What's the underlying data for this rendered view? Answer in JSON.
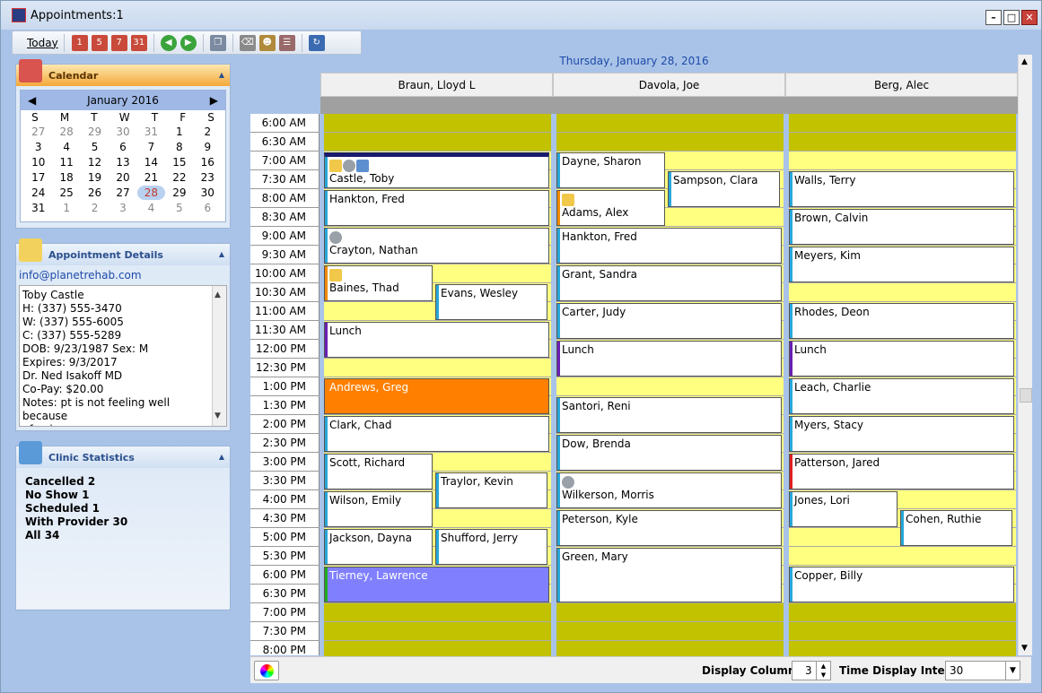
{
  "window": {
    "title": "Appointments:1"
  },
  "toolbar": {
    "today_label": "Today"
  },
  "calendar": {
    "panel_title": "Calendar",
    "month_label": "January 2016",
    "dow": [
      "S",
      "M",
      "T",
      "W",
      "T",
      "F",
      "S"
    ],
    "days": [
      {
        "d": "27",
        "o": true
      },
      {
        "d": "28",
        "o": true
      },
      {
        "d": "29",
        "o": true
      },
      {
        "d": "30",
        "o": true
      },
      {
        "d": "31",
        "o": true
      },
      {
        "d": "1"
      },
      {
        "d": "2"
      },
      {
        "d": "3"
      },
      {
        "d": "4"
      },
      {
        "d": "5"
      },
      {
        "d": "6"
      },
      {
        "d": "7"
      },
      {
        "d": "8"
      },
      {
        "d": "9"
      },
      {
        "d": "10"
      },
      {
        "d": "11"
      },
      {
        "d": "12"
      },
      {
        "d": "13"
      },
      {
        "d": "14"
      },
      {
        "d": "15"
      },
      {
        "d": "16"
      },
      {
        "d": "17"
      },
      {
        "d": "18"
      },
      {
        "d": "19"
      },
      {
        "d": "20"
      },
      {
        "d": "21"
      },
      {
        "d": "22"
      },
      {
        "d": "23"
      },
      {
        "d": "24"
      },
      {
        "d": "25"
      },
      {
        "d": "26"
      },
      {
        "d": "27"
      },
      {
        "d": "28",
        "sel": true
      },
      {
        "d": "29"
      },
      {
        "d": "30"
      },
      {
        "d": "31"
      },
      {
        "d": "1",
        "o": true
      },
      {
        "d": "2",
        "o": true
      },
      {
        "d": "3",
        "o": true
      },
      {
        "d": "4",
        "o": true
      },
      {
        "d": "5",
        "o": true
      },
      {
        "d": "6",
        "o": true
      }
    ]
  },
  "details": {
    "panel_title": "Appointment Details",
    "email": "info@planetrehab.com",
    "lines": [
      "Toby  Castle",
      "H: (337) 555-3470",
      "W: (337) 555-6005",
      "C: (337) 555-5289",
      "DOB: 9/23/1987 Sex: M",
      "Expires: 9/3/2017",
      "Dr. Ned  Isakoff MD",
      "Co-Pay: $20.00",
      "Notes: pt is not feeling well because",
      "of pain."
    ]
  },
  "stats": {
    "panel_title": "Clinic Statistics",
    "lines": [
      "Cancelled 2",
      "No Show 1",
      "Scheduled 1",
      "With Provider 30",
      "All 34"
    ]
  },
  "schedule": {
    "date_label": "Thursday, January 28, 2016",
    "times": [
      "6:00 AM",
      "6:30 AM",
      "7:00 AM",
      "7:30 AM",
      "8:00 AM",
      "8:30 AM",
      "9:00 AM",
      "9:30 AM",
      "10:00 AM",
      "10:30 AM",
      "11:00 AM",
      "11:30 AM",
      "12:00 PM",
      "12:30 PM",
      "1:00 PM",
      "1:30 PM",
      "2:00 PM",
      "2:30 PM",
      "3:00 PM",
      "3:30 PM",
      "4:00 PM",
      "4:30 PM",
      "5:00 PM",
      "5:30 PM",
      "6:00 PM",
      "6:30 PM",
      "7:00 PM",
      "7:30 PM",
      "8:00 PM"
    ],
    "resources": [
      {
        "name": "Braun, Lloyd L",
        "closed_slots": [
          0,
          1,
          26,
          27,
          28
        ],
        "appointments": [
          {
            "name": "Castle, Toby",
            "start": 2,
            "len": 2,
            "half": "full",
            "icons": [
              "note",
              "dollar",
              "grid"
            ],
            "bar": "#29a7d8",
            "topbar": true
          },
          {
            "name": "Hankton, Fred",
            "start": 4,
            "len": 2,
            "half": "full",
            "bar": "#29a7d8"
          },
          {
            "name": "Crayton, Nathan",
            "start": 6,
            "len": 2,
            "half": "full",
            "icons": [
              "dollar"
            ],
            "bar": "#29a7d8"
          },
          {
            "name": "Baines, Thad",
            "start": 8,
            "len": 2,
            "half": "left",
            "icons": [
              "note"
            ],
            "bar": "#f08a00"
          },
          {
            "name": "Evans, Wesley",
            "start": 9,
            "len": 2,
            "half": "right",
            "bar": "#29a7d8"
          },
          {
            "name": "Lunch",
            "start": 11,
            "len": 2,
            "half": "full",
            "bar": "#6a1fb0"
          },
          {
            "name": "Andrews, Greg",
            "start": 14,
            "len": 2,
            "half": "full",
            "bg": "#ff8000",
            "fg": "#ffffff",
            "bar": "#ff8000"
          },
          {
            "name": "Clark, Chad",
            "start": 16,
            "len": 2,
            "half": "full",
            "bar": "#29a7d8"
          },
          {
            "name": "Scott, Richard",
            "start": 18,
            "len": 2,
            "half": "left",
            "bar": "#29a7d8"
          },
          {
            "name": "Traylor, Kevin",
            "start": 19,
            "len": 2,
            "half": "right",
            "bar": "#29a7d8"
          },
          {
            "name": "Wilson, Emily",
            "start": 20,
            "len": 2,
            "half": "left",
            "bar": "#29a7d8"
          },
          {
            "name": "Jackson, Dayna",
            "start": 22,
            "len": 2,
            "half": "left",
            "bar": "#29a7d8"
          },
          {
            "name": "Shufford, Jerry",
            "start": 22,
            "len": 2,
            "half": "right",
            "bar": "#29a7d8"
          },
          {
            "name": "Tierney, Lawrence",
            "start": 24,
            "len": 2,
            "half": "full",
            "bg": "#8080ff",
            "fg": "#ffffff",
            "bar": "#22aa22"
          }
        ]
      },
      {
        "name": "Davola, Joe",
        "closed_slots": [
          0,
          1,
          26,
          27,
          28
        ],
        "appointments": [
          {
            "name": "Dayne, Sharon",
            "start": 2,
            "len": 2,
            "half": "left",
            "bar": "#29a7d8"
          },
          {
            "name": "Sampson, Clara",
            "start": 3,
            "len": 2,
            "half": "right",
            "bar": "#29a7d8"
          },
          {
            "name": "Adams, Alex",
            "start": 4,
            "len": 2,
            "half": "left",
            "icons": [
              "note"
            ],
            "bar": "#f08a00"
          },
          {
            "name": "Hankton, Fred",
            "start": 6,
            "len": 2,
            "half": "full",
            "bar": "#29a7d8"
          },
          {
            "name": "Grant, Sandra",
            "start": 8,
            "len": 2,
            "half": "full",
            "bar": "#29a7d8"
          },
          {
            "name": "Carter, Judy",
            "start": 10,
            "len": 2,
            "half": "full",
            "bar": "#29a7d8"
          },
          {
            "name": "Lunch",
            "start": 12,
            "len": 2,
            "half": "full",
            "bar": "#6a1fb0"
          },
          {
            "name": "Santori, Reni",
            "start": 15,
            "len": 2,
            "half": "full",
            "bar": "#29a7d8"
          },
          {
            "name": "Dow, Brenda",
            "start": 17,
            "len": 2,
            "half": "full",
            "bar": "#29a7d8"
          },
          {
            "name": "Wilkerson, Morris",
            "start": 19,
            "len": 2,
            "half": "full",
            "icons": [
              "dollar"
            ],
            "bar": "#29a7d8"
          },
          {
            "name": "Peterson, Kyle",
            "start": 21,
            "len": 2,
            "half": "full",
            "bar": "#29a7d8"
          },
          {
            "name": "Green, Mary",
            "start": 23,
            "len": 3,
            "half": "full",
            "bar": "#29a7d8"
          }
        ]
      },
      {
        "name": "Berg, Alec",
        "closed_slots": [
          0,
          1,
          26,
          27,
          28
        ],
        "appointments": [
          {
            "name": "Walls, Terry",
            "start": 3,
            "len": 2,
            "half": "full",
            "bar": "#29a7d8"
          },
          {
            "name": "Brown, Calvin",
            "start": 5,
            "len": 2,
            "half": "full",
            "bar": "#29a7d8"
          },
          {
            "name": "Meyers, Kim",
            "start": 7,
            "len": 2,
            "half": "full",
            "bar": "#29a7d8"
          },
          {
            "name": "Rhodes, Deon",
            "start": 10,
            "len": 2,
            "half": "full",
            "bar": "#29a7d8"
          },
          {
            "name": "Lunch",
            "start": 12,
            "len": 2,
            "half": "full",
            "bar": "#6a1fb0"
          },
          {
            "name": "Leach, Charlie",
            "start": 14,
            "len": 2,
            "half": "full",
            "bar": "#29a7d8"
          },
          {
            "name": "Myers, Stacy",
            "start": 16,
            "len": 2,
            "half": "full",
            "bar": "#29a7d8"
          },
          {
            "name": "Patterson, Jared",
            "start": 18,
            "len": 2,
            "half": "full",
            "bar": "#e02020"
          },
          {
            "name": "Jones, Lori",
            "start": 20,
            "len": 2,
            "half": "left",
            "bar": "#29a7d8"
          },
          {
            "name": "Cohen, Ruthie",
            "start": 21,
            "len": 2,
            "half": "right",
            "bar": "#29a7d8"
          },
          {
            "name": "Copper, Billy",
            "start": 24,
            "len": 2,
            "half": "full",
            "bar": "#29a7d8"
          }
        ]
      }
    ]
  },
  "bottom": {
    "display_columns_label": "Display Columns",
    "display_columns_value": "3",
    "interval_label": "Time Display Interval",
    "interval_value": "30"
  },
  "colors": {
    "open_slot": "#ffff80",
    "closed_slot": "#c2c200",
    "accent": "#1e4aa8"
  }
}
